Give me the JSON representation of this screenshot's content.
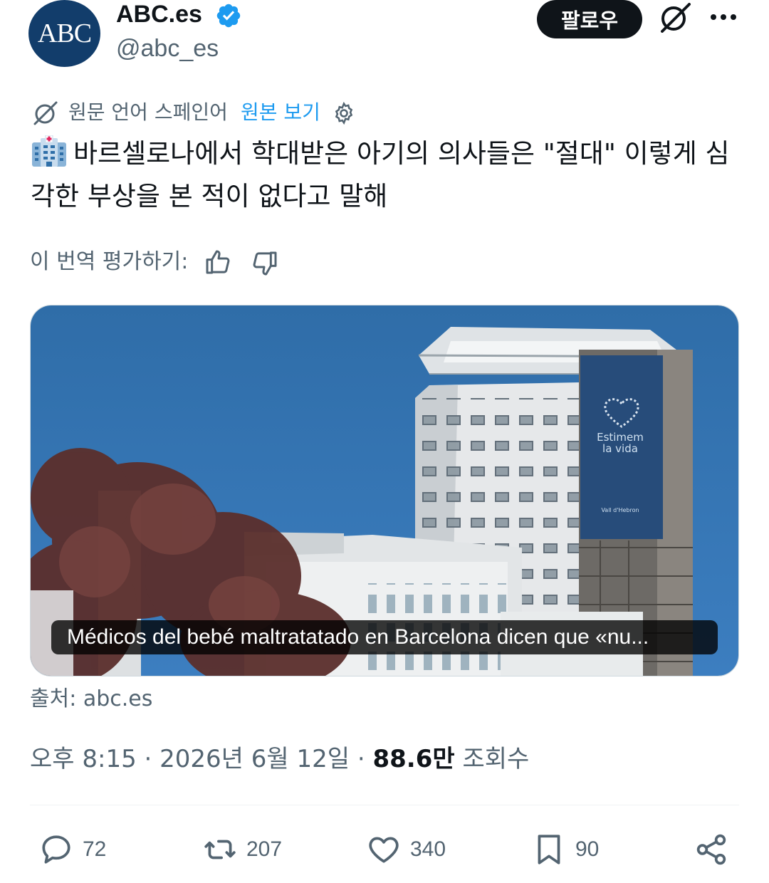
{
  "author": {
    "avatar_text": "ABC",
    "display_name": "ABC.es",
    "handle": "@abc_es"
  },
  "header": {
    "follow_label": "팔로우"
  },
  "translation": {
    "label": "원문 언어 스페인어",
    "view_original": "원본 보기"
  },
  "tweet": {
    "text": "바르셀로나에서 학대받은 아기의 의사들은 \"절대\" 이렇게 심각한 부상을 본 적이 없다고 말해"
  },
  "rate_translation": {
    "label": "이 번역 평가하기:"
  },
  "media": {
    "caption": "Médicos del bebé maltratatado en Barcelona dicen que «nu...",
    "banner_text_1": "Estimem",
    "banner_text_2": "la vida",
    "banner_logo_text": "Vall d'Hebron",
    "source": "출처: abc.es"
  },
  "meta": {
    "time": "오후 8:15",
    "date": "2026년 6월 12일",
    "views_count": "88.6만",
    "views_label": "조회수"
  },
  "actions": {
    "replies": "72",
    "reposts": "207",
    "likes": "340",
    "bookmarks": "90"
  },
  "colors": {
    "accent": "#1d9bf0",
    "text_primary": "#0f1419",
    "text_secondary": "#536471",
    "avatar_bg": "#123d6b"
  }
}
